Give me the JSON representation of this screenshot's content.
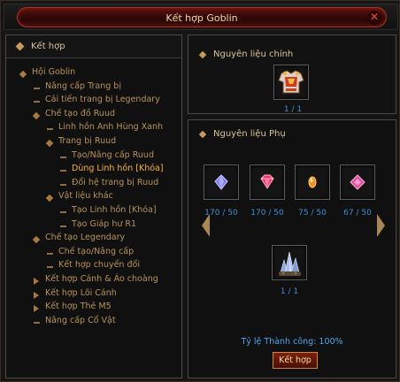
{
  "window": {
    "title": "Kết hợp Goblin",
    "close_symbol": "✕"
  },
  "left_panel": {
    "header": "Kết hợp",
    "tree": [
      {
        "label": "Hội Goblin",
        "icon": "open",
        "depth": 0,
        "selected": false
      },
      {
        "label": "Nâng cấp Trang bị",
        "icon": "leaf",
        "depth": 1,
        "selected": false
      },
      {
        "label": "Cải tiến trang bị Legendary",
        "icon": "leaf",
        "depth": 1,
        "selected": false
      },
      {
        "label": "Chế tạo đồ Ruud",
        "icon": "open",
        "depth": 1,
        "selected": false
      },
      {
        "label": "Linh hồn Anh Hùng Xanh",
        "icon": "leaf",
        "depth": 2,
        "selected": false
      },
      {
        "label": "Trang bị Ruud",
        "icon": "open",
        "depth": 2,
        "selected": false
      },
      {
        "label": "Tạo/Nâng cấp Ruud",
        "icon": "leaf",
        "depth": 3,
        "selected": false
      },
      {
        "label": "Dùng Linh hồn [Khóa]",
        "icon": "leaf",
        "depth": 3,
        "selected": true
      },
      {
        "label": "Đổi hệ trang bị Ruud",
        "icon": "leaf",
        "depth": 3,
        "selected": false
      },
      {
        "label": "Vật liệu khác",
        "icon": "open",
        "depth": 2,
        "selected": false
      },
      {
        "label": "Tạo Linh hồn [Khóa]",
        "icon": "leaf",
        "depth": 3,
        "selected": false
      },
      {
        "label": "Tạo Giáp hư R1",
        "icon": "leaf",
        "depth": 3,
        "selected": false
      },
      {
        "label": "Chế tạo Legendary",
        "icon": "open",
        "depth": 1,
        "selected": false
      },
      {
        "label": "Chế tạo/Nâng cấp",
        "icon": "leaf",
        "depth": 2,
        "selected": false
      },
      {
        "label": "Kết hợp chuyển đổi",
        "icon": "leaf",
        "depth": 2,
        "selected": false
      },
      {
        "label": "Kết hợp Cánh & Áo choàng",
        "icon": "closed",
        "depth": 1,
        "selected": false
      },
      {
        "label": "Kết hợp Lõi Cánh",
        "icon": "closed",
        "depth": 1,
        "selected": false
      },
      {
        "label": "Kết hợp Thẻ M5",
        "icon": "closed",
        "depth": 1,
        "selected": false
      },
      {
        "label": "Nâng cấp Cổ Vật",
        "icon": "leaf",
        "depth": 1,
        "selected": false
      }
    ]
  },
  "main_material": {
    "title": "Nguyên liệu chính",
    "item_icon": "ruud-armor-icon",
    "count": "1 / 1"
  },
  "sub_materials": {
    "title": "Nguyên liệu Phụ",
    "items": [
      {
        "icon": "blue-gem-icon",
        "color": "#7e7ef0",
        "count": "170 / 50"
      },
      {
        "icon": "pink-gem-icon",
        "color": "#ee3a6a",
        "count": "170 / 50"
      },
      {
        "icon": "orange-gem-icon",
        "color": "#f29020",
        "count": "75 / 50"
      },
      {
        "icon": "magenta-gem-icon",
        "color": "#e04f9a",
        "count": "67 / 50"
      }
    ],
    "crystal": {
      "icon": "crystal-cluster-icon",
      "count": "1 / 1"
    }
  },
  "success_rate": "Tỷ lệ Thành công: 100%",
  "combine_button": "Kết hợp"
}
